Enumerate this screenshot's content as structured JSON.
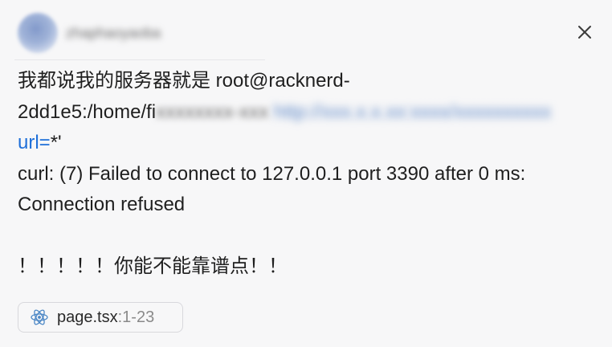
{
  "header": {
    "username": "zhaphaoyaoba"
  },
  "message": {
    "line1": "我都说我的服务器就是 root@racknerd-",
    "line2_prefix": "2dd1e5:/home/fi",
    "line2_path_blurred": "xxxxxxxx-xxx",
    "line2_link_blurred": "http://xxx.x.x.xx:xxxx/xxxxxxxxxx",
    "line3_key": "url=",
    "line3_rest": "*'",
    "line4": "curl: (7) Failed to connect to 127.0.0.1 port 3390 after 0 ms:",
    "line5": "Connection refused",
    "line6": "！！！！！你能不能靠谱点！！"
  },
  "attachment": {
    "filename": "page.tsx",
    "range": ":1-23",
    "icon": "react-icon"
  },
  "colors": {
    "background": "#f7f7f8",
    "text": "#1f1f1f",
    "link": "#1e6fd9",
    "muted": "#8a8a8a"
  }
}
